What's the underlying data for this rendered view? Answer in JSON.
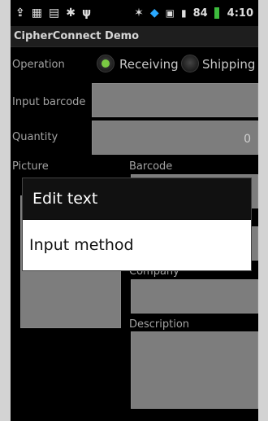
{
  "status_bar": {
    "left_icons": [
      "upload-icon",
      "barcode-app-icon",
      "sim-icon",
      "android-debug-icon",
      "usb-icon"
    ],
    "right_icons": [
      "bluetooth-icon",
      "wifi-icon",
      "lock-icon",
      "signal-icon"
    ],
    "battery_percent": "84",
    "time": "4:10"
  },
  "app": {
    "title": "CipherConnect Demo"
  },
  "form": {
    "operation_label": "Operation",
    "operation_options": [
      {
        "label": "Receiving",
        "selected": true
      },
      {
        "label": "Shipping",
        "selected": false
      }
    ],
    "input_barcode_label": "Input barcode",
    "input_barcode_value": "",
    "quantity_label": "Quantity",
    "quantity_value": "0",
    "picture_label": "Picture",
    "barcode_label": "Barcode",
    "company_label": "Company",
    "description_label": "Description"
  },
  "dialog": {
    "title": "Edit text",
    "items": [
      "Input method"
    ]
  },
  "colors": {
    "accent_green": "#7ac943",
    "wifi_blue": "#2aa9ff",
    "battery_green": "#3dbb3d"
  }
}
